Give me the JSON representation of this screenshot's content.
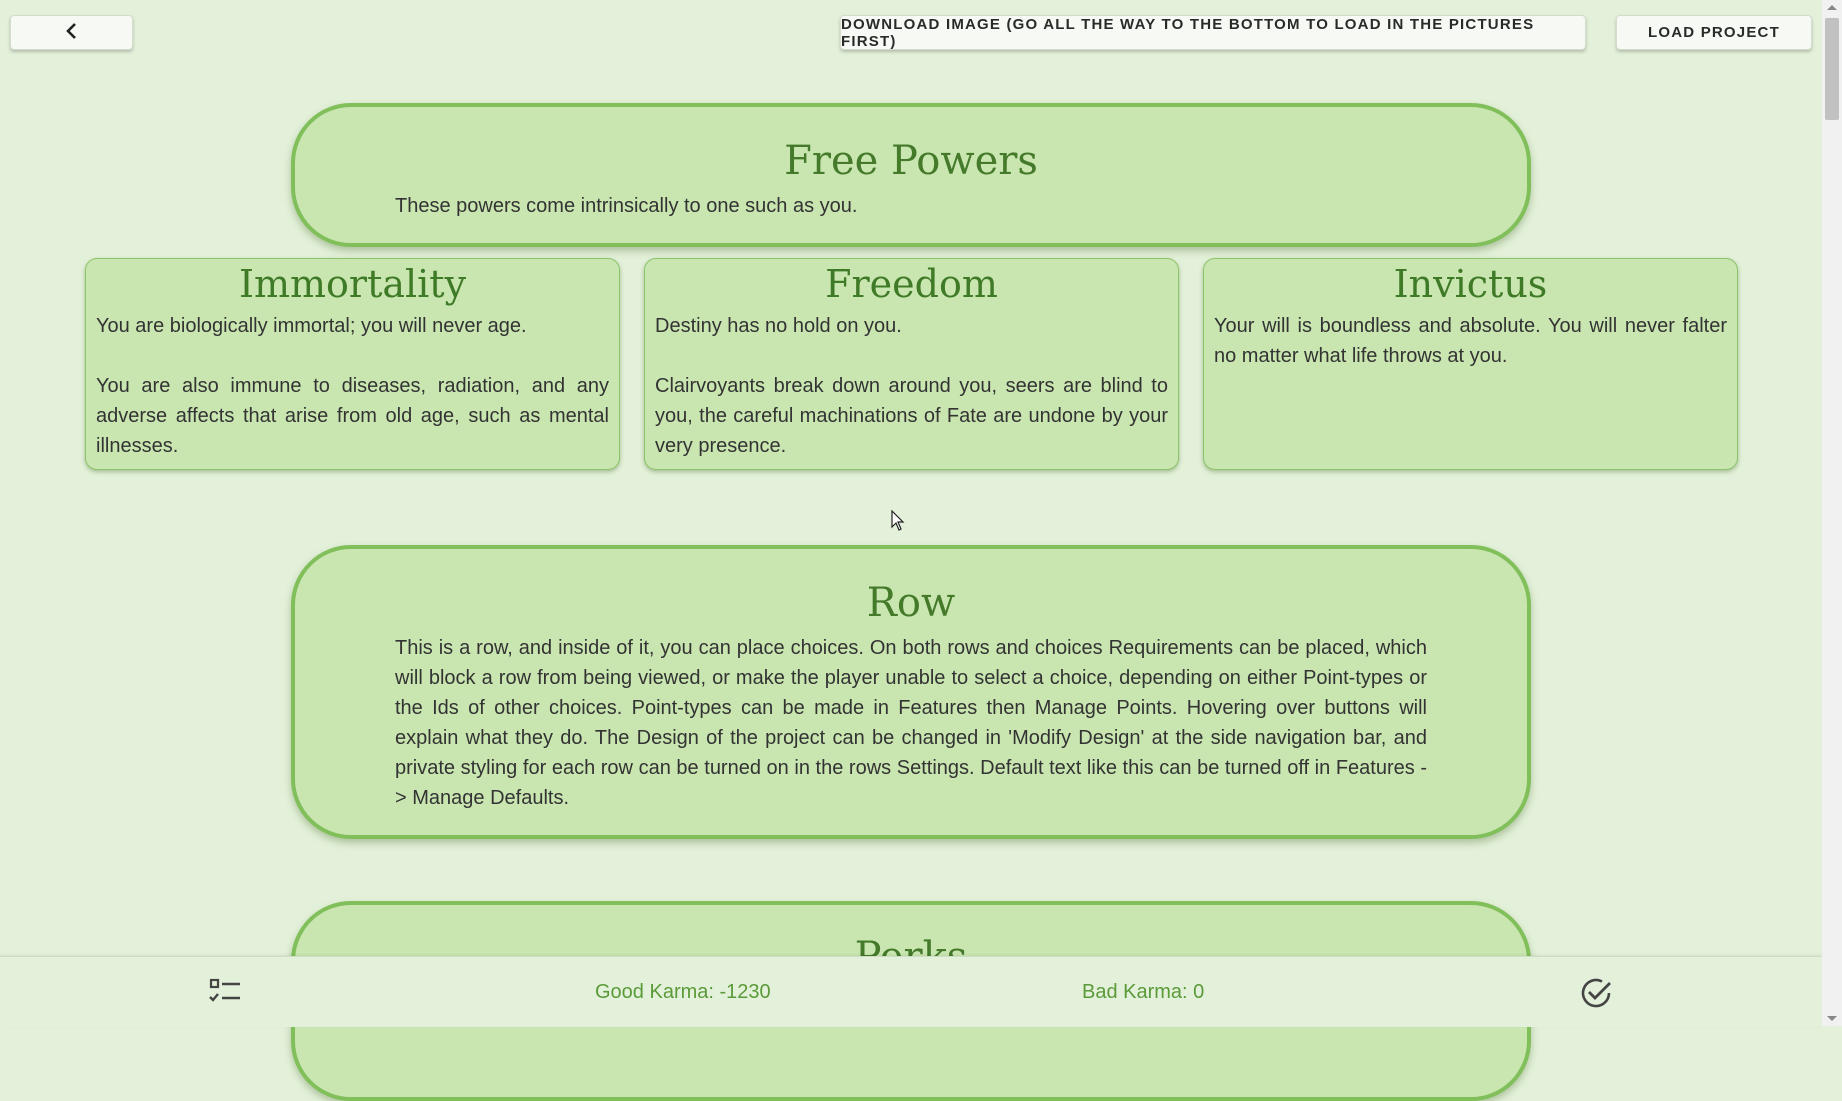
{
  "toolbar": {
    "back_icon": "chevron-left-icon",
    "download_label": "DOWNLOAD IMAGE (GO ALL THE WAY TO THE BOTTOM TO LOAD IN THE PICTURES FIRST)",
    "load_label": "LOAD PROJECT"
  },
  "rows": [
    {
      "title": "Free Powers",
      "text": "These powers come intrinsically to one such as you."
    },
    {
      "title": "Row",
      "text": "This is a row, and inside of it, you can place choices. On both rows and choices Requirements can be placed, which will block a row from being viewed, or make the player unable to select a choice, depending on either Point-types or the Ids of other choices. Point-types can be made in Features then Manage Points. Hovering over buttons will explain what they do. The Design of the project can be changed in 'Modify Design' at the side navigation bar, and private styling for each row can be turned on in the rows Settings. Default text like this can be turned off in Features -> Manage Defaults."
    },
    {
      "title": "Perks"
    }
  ],
  "choices": [
    {
      "title": "Immortality",
      "text": "You are biologically immortal; you will never age.\n\nYou are also immune to diseases, radiation, and any adverse affects that arise from old age, such as mental illnesses."
    },
    {
      "title": "Freedom",
      "text": "Destiny has no hold on you.\n\nClairvoyants break down around you, seers are blind to you, the careful machinations of Fate are undone by your very presence."
    },
    {
      "title": "Invictus",
      "text": "Your will is boundless and absolute. You will never falter no matter what life throws at you."
    }
  ],
  "bottom_bar": {
    "list_icon": "checklist-icon",
    "good_karma": "Good Karma: -1230",
    "bad_karma": "Bad Karma: 0",
    "check_icon": "check-circle-icon"
  },
  "colors": {
    "background": "#e4f1da",
    "row_fill": "#c9e6b1",
    "row_border": "#80bf5a",
    "title_green": "#447a2a",
    "karma_green": "#5a9a38"
  }
}
